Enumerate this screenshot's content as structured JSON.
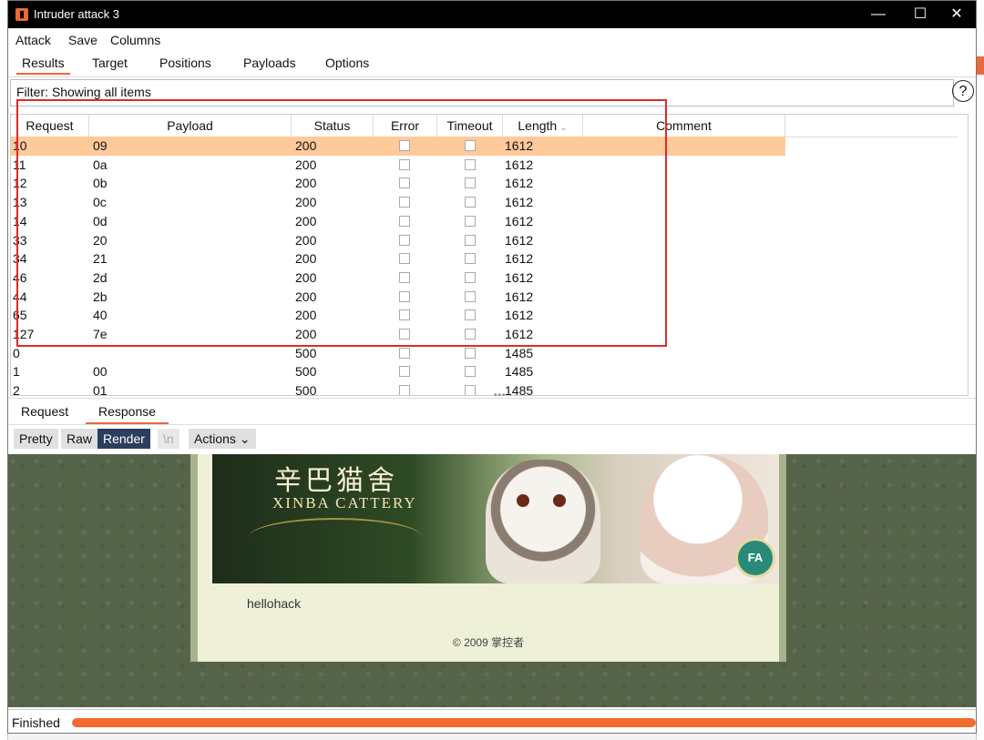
{
  "window": {
    "title": "Intruder attack 3",
    "controls": {
      "minimize": "—",
      "maximize": "☐",
      "close": "✕"
    }
  },
  "menubar": [
    "Attack",
    "Save",
    "Columns"
  ],
  "tabs": [
    "Results",
    "Target",
    "Positions",
    "Payloads",
    "Options"
  ],
  "active_tab": "Results",
  "filter": {
    "text": "Filter: Showing all items",
    "help_icon": "?"
  },
  "table": {
    "columns": [
      "Request",
      "Payload",
      "Status",
      "Error",
      "Timeout",
      "Length",
      "Comment"
    ],
    "sort_column": "Length",
    "rows": [
      {
        "request": "10",
        "payload": "09",
        "status": "200",
        "length": "1612",
        "selected": true
      },
      {
        "request": "11",
        "payload": "0a",
        "status": "200",
        "length": "1612"
      },
      {
        "request": "12",
        "payload": "0b",
        "status": "200",
        "length": "1612"
      },
      {
        "request": "13",
        "payload": "0c",
        "status": "200",
        "length": "1612"
      },
      {
        "request": "14",
        "payload": "0d",
        "status": "200",
        "length": "1612"
      },
      {
        "request": "33",
        "payload": "20",
        "status": "200",
        "length": "1612"
      },
      {
        "request": "34",
        "payload": "21",
        "status": "200",
        "length": "1612"
      },
      {
        "request": "46",
        "payload": "2d",
        "status": "200",
        "length": "1612"
      },
      {
        "request": "44",
        "payload": "2b",
        "status": "200",
        "length": "1612"
      },
      {
        "request": "65",
        "payload": "40",
        "status": "200",
        "length": "1612"
      },
      {
        "request": "127",
        "payload": "7e",
        "status": "200",
        "length": "1612"
      },
      {
        "request": "0",
        "payload": "",
        "status": "500",
        "length": "1485"
      },
      {
        "request": "1",
        "payload": "00",
        "status": "500",
        "length": "1485"
      },
      {
        "request": "2",
        "payload": "01",
        "status": "500",
        "length": "1485"
      }
    ]
  },
  "response_tabs": [
    "Request",
    "Response"
  ],
  "active_response_tab": "Response",
  "view_buttons": [
    "Pretty",
    "Raw",
    "Render",
    "\\n",
    "Actions"
  ],
  "active_view": "Render",
  "render": {
    "brand_cn": "辛巴猫舍",
    "brand_en": "XINBA CATTERY",
    "seal": "FA",
    "body_text": "hellohack",
    "copyright": "© 2009 掌控者"
  },
  "status": {
    "text": "Finished",
    "progress": 1.0
  },
  "colors": {
    "accent": "#e8693a",
    "selected_row": "#ffc99a",
    "highlight_box": "#e02a2a",
    "progress": "#f26b2c"
  }
}
